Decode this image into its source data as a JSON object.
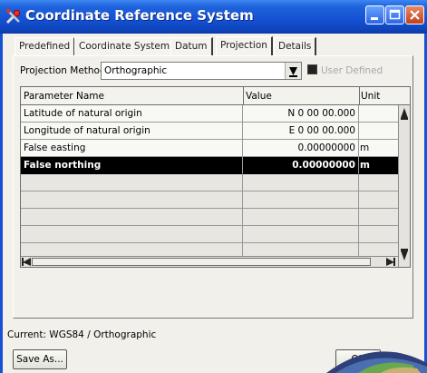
{
  "window": {
    "title": "Coordinate Reference System",
    "icon": "tools-icon"
  },
  "tabs": [
    {
      "label": "Predefined",
      "active": false
    },
    {
      "label": "Coordinate System",
      "active": false
    },
    {
      "label": "Datum",
      "active": false
    },
    {
      "label": "Projection",
      "active": true
    },
    {
      "label": "Details",
      "active": false
    }
  ],
  "projection": {
    "method_label": "Projection Method",
    "method_value": "Orthographic",
    "user_defined_label": "User Defined",
    "user_defined_checked": true
  },
  "table": {
    "columns": [
      "Parameter Name",
      "Value",
      "Unit"
    ],
    "rows": [
      {
        "name": "Latitude of natural origin",
        "value": "N 0 00 00.000",
        "unit": ""
      },
      {
        "name": "Longitude of natural origin",
        "value": "E 0 00 00.000",
        "unit": ""
      },
      {
        "name": "False easting",
        "value": "0.00000000",
        "unit": "m"
      },
      {
        "name": "False northing",
        "value": "0.00000000",
        "unit": "m",
        "selected": true
      }
    ]
  },
  "status": {
    "current": "Current: WGS84 / Orthographic"
  },
  "buttons": {
    "save_as": "Save As...",
    "ok": "OK"
  },
  "colors": {
    "titlebar": "#1553d4",
    "selected_row": "#000000"
  }
}
